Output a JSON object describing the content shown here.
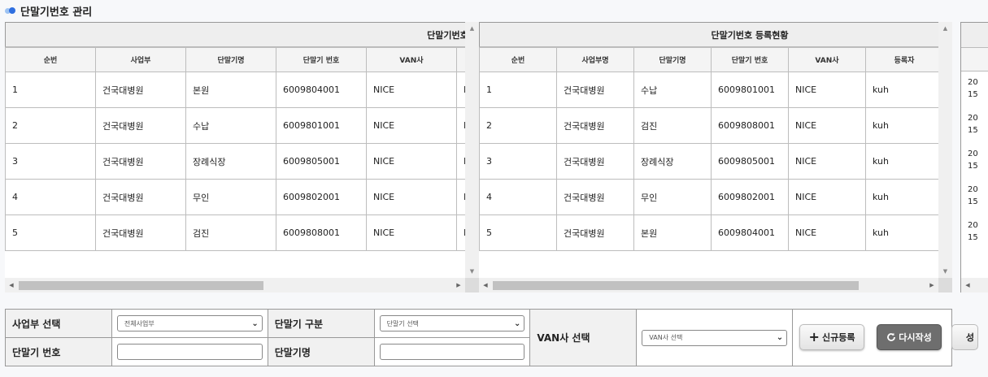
{
  "page": {
    "title": "단말기번호 관리"
  },
  "colors": {
    "accent": "#2f6fe0",
    "accent_light": "#9ec3f2",
    "reset_button": "#6e6e6e"
  },
  "panel1": {
    "caption": "단말기번호 원장",
    "headers": [
      "순번",
      "사업부",
      "단말기명",
      "단말기 번호",
      "VAN사"
    ],
    "rows": [
      {
        "no": "1",
        "division": "건국대병원",
        "name": "본원",
        "number": "6009804001",
        "van": "NICE",
        "cut": "N"
      },
      {
        "no": "2",
        "division": "건국대병원",
        "name": "수납",
        "number": "6009801001",
        "van": "NICE",
        "cut": "N"
      },
      {
        "no": "3",
        "division": "건국대병원",
        "name": "장례식장",
        "number": "6009805001",
        "van": "NICE",
        "cut": "N"
      },
      {
        "no": "4",
        "division": "건국대병원",
        "name": "무인",
        "number": "6009802001",
        "van": "NICE",
        "cut": "N"
      },
      {
        "no": "5",
        "division": "건국대병원",
        "name": "검진",
        "number": "6009808001",
        "van": "NICE",
        "cut": "N"
      }
    ]
  },
  "panel2": {
    "caption": "단말기번호 등록현황",
    "headers": [
      "순번",
      "사업부명",
      "단말기명",
      "단말기 번호",
      "VAN사",
      "등록자"
    ],
    "rows": [
      {
        "no": "1",
        "division": "건국대병원",
        "name": "수납",
        "number": "6009801001",
        "van": "NICE",
        "user": "kuh"
      },
      {
        "no": "2",
        "division": "건국대병원",
        "name": "검진",
        "number": "6009808001",
        "van": "NICE",
        "user": "kuh"
      },
      {
        "no": "3",
        "division": "건국대병원",
        "name": "장례식장",
        "number": "6009805001",
        "van": "NICE",
        "user": "kuh"
      },
      {
        "no": "4",
        "division": "건국대병원",
        "name": "무인",
        "number": "6009802001",
        "van": "NICE",
        "user": "kuh"
      },
      {
        "no": "5",
        "division": "건국대병원",
        "name": "본원",
        "number": "6009804001",
        "van": "NICE",
        "user": "kuh"
      }
    ]
  },
  "panel3": {
    "date_fragment_top": "20",
    "date_fragment_bottom": "15"
  },
  "form": {
    "division_label": "사업부 선택",
    "division_value": "전체사업부",
    "type_label": "단말기 구분",
    "type_placeholder": "단말기 선택",
    "van_label": "VAN사 선택",
    "van_placeholder": "VAN사 선택",
    "number_label": "단말기 번호",
    "name_label": "단말기명",
    "new_button": "신규등록",
    "reset_button": "다시작성",
    "peek_button": "성"
  }
}
